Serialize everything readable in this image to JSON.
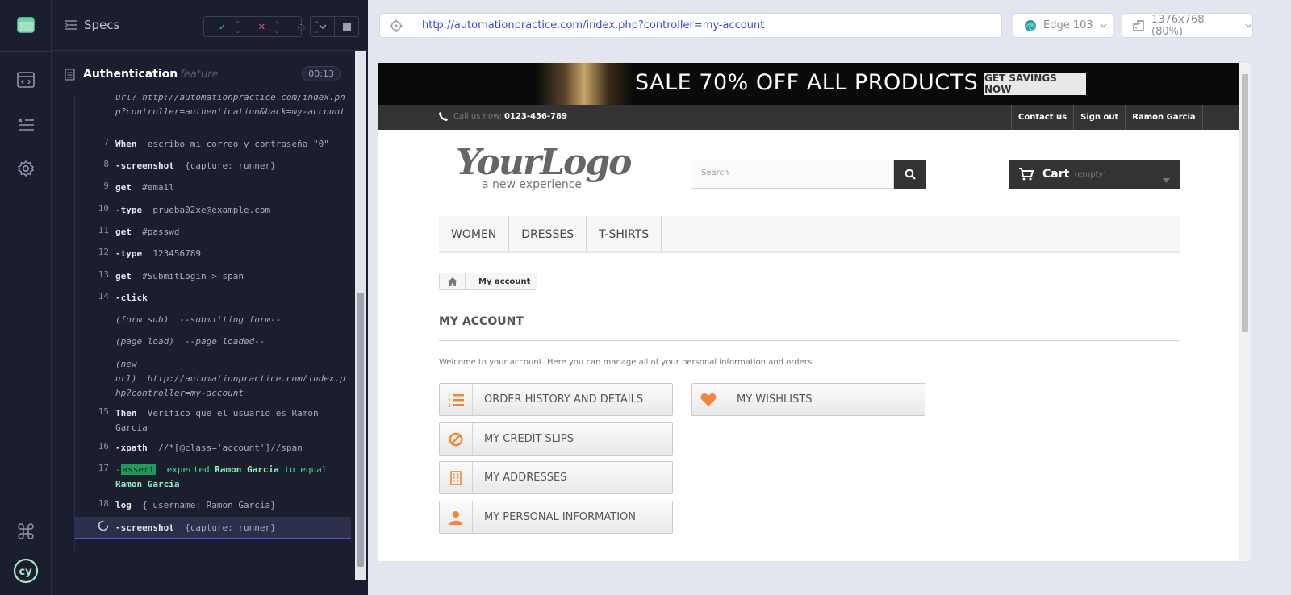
{
  "reporter": {
    "specs_label": "Specs",
    "stats": {
      "passed": "--",
      "failed": "--",
      "pending": "--"
    },
    "suite": {
      "title": "Authentication",
      "kind": "feature",
      "duration": "00:13"
    },
    "commands": [
      {
        "num": "",
        "name": "",
        "text": "url? http://automationpractice.com/index.php?controller=authentication&back=my-account"
      },
      {
        "num": "7",
        "name": "When",
        "text": "escribo mi correo y contraseña \"0\""
      },
      {
        "num": "8",
        "name": "-screenshot",
        "text": "{capture: runner}"
      },
      {
        "num": "9",
        "name": "get",
        "text": "#email"
      },
      {
        "num": "10",
        "name": "-type",
        "text": "prueba02xe@example.com"
      },
      {
        "num": "11",
        "name": "get",
        "text": "#passwd"
      },
      {
        "num": "12",
        "name": "-type",
        "text": "123456789"
      },
      {
        "num": "13",
        "name": "get",
        "text": "#SubmitLogin > span"
      },
      {
        "num": "14",
        "name": "-click",
        "text": ""
      },
      {
        "num": "",
        "name": "(form sub)",
        "text": "--submitting form--"
      },
      {
        "num": "",
        "name": "(page load)",
        "text": "--page loaded--"
      },
      {
        "num": "",
        "name": "(new url)",
        "text": "http://automationpractice.com/index.php?controller=my-account"
      },
      {
        "num": "15",
        "name": "Then",
        "text": "Verifico que el usuario es Ramon Garcia"
      },
      {
        "num": "16",
        "name": "-xpath",
        "text": "//*[@class='account']//span"
      },
      {
        "num": "17",
        "name": "-assert",
        "text": "expected Ramon Garcia to equal Ramon Garcia"
      },
      {
        "num": "18",
        "name": "log",
        "text": "{_username: Ramon Garcia}"
      },
      {
        "num": "",
        "name": "-screenshot",
        "text": "{capture: runner}"
      }
    ],
    "assert_parts": {
      "badge": "assert",
      "expected": "expected",
      "actual": "Ramon Garcia",
      "to_equal": "to equal",
      "target": "Ramon Garcia"
    },
    "url_first": {
      "label": "url?",
      "value": "http://automationpractice.com/index.php?controller=authentication&back=my-account"
    },
    "new_url": {
      "label_a": "(new",
      "label_b": "url)",
      "value": "http://automationpractice.com/index.php?controller=my-account"
    }
  },
  "aut": {
    "url": "http://automationpractice.com/index.php?controller=my-account",
    "browser": "Edge 103",
    "viewport": "1376x768 (80%)"
  },
  "site": {
    "banner_text": "SALE 70% OFF ALL PRODUCTS",
    "banner_button": "GET SAVINGS NOW",
    "call_us": "Call us now:",
    "phone": "0123-456-789",
    "top_links": [
      "Contact us",
      "Sign out",
      "Ramon Garcia"
    ],
    "logo_main": "YourLogo",
    "logo_sub": "a new experience",
    "search_placeholder": "Search",
    "cart_label": "Cart",
    "cart_empty": "(empty)",
    "menu": [
      "WOMEN",
      "DRESSES",
      "T-SHIRTS"
    ],
    "breadcrumb_current": "My account",
    "heading": "MY ACCOUNT",
    "welcome": "Welcome to your account. Here you can manage all of your personal information and orders.",
    "buttons": {
      "order_history": "ORDER HISTORY AND DETAILS",
      "credit_slips": "MY CREDIT SLIPS",
      "addresses": "MY ADDRESSES",
      "personal_info": "MY PERSONAL INFORMATION",
      "wishlists": "MY WISHLISTS"
    }
  },
  "colors": {
    "accent_orange": "#f0863a",
    "runner_bg": "#1b1e2e",
    "active_blue": "#4956e3",
    "pass_green": "#3fc07b",
    "fail_red": "#ef5a6a"
  }
}
